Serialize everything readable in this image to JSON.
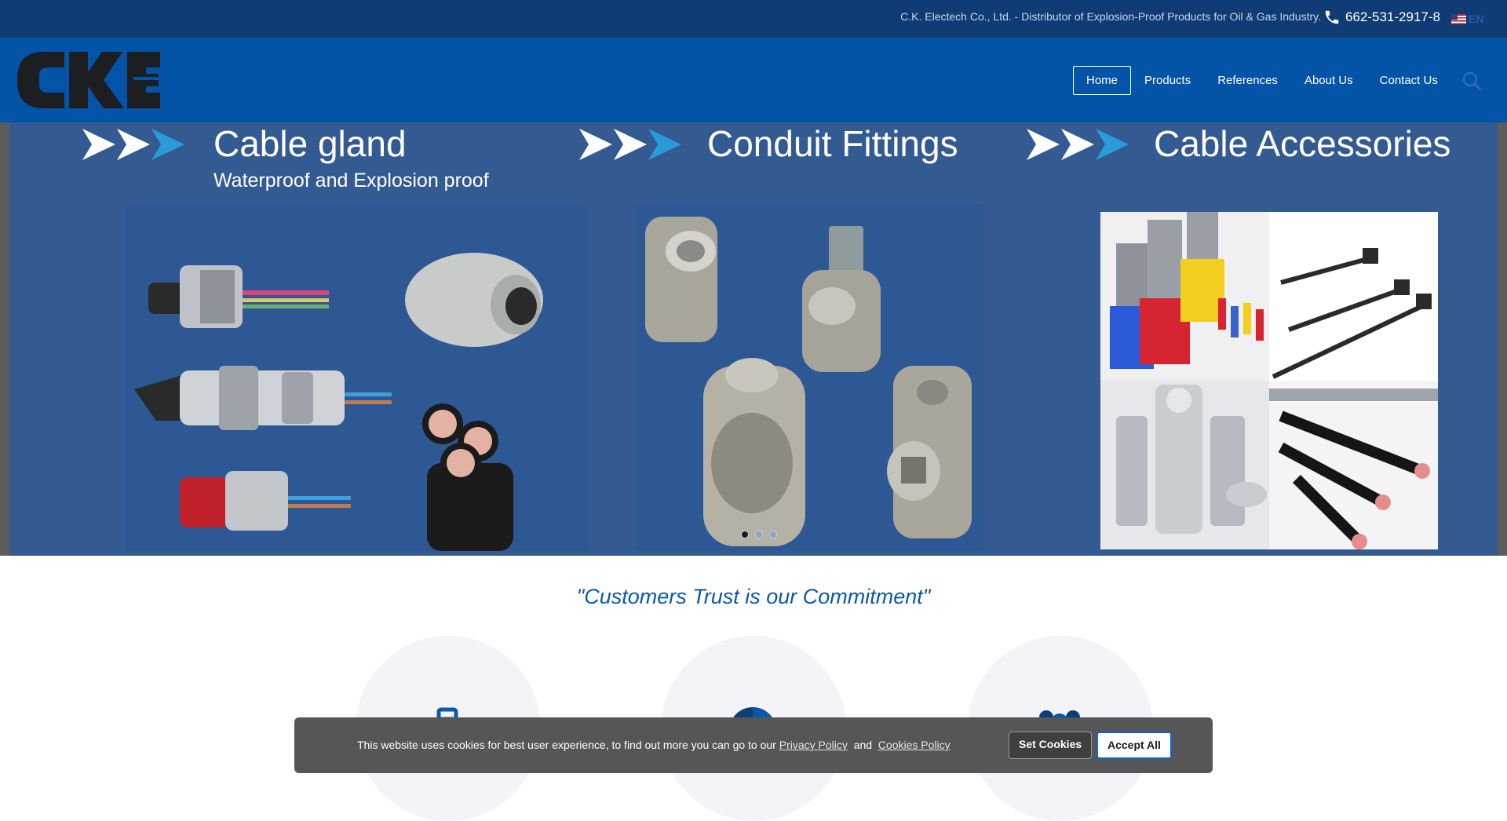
{
  "topbar": {
    "tagline": "C.K. Electech Co., Ltd. - Distributor of Explosion-Proof Products for Oil & Gas Industry.",
    "phone": "662-531-2917-8",
    "language": "EN"
  },
  "nav": {
    "items": [
      {
        "label": "Home",
        "active": true
      },
      {
        "label": "Products",
        "active": false
      },
      {
        "label": "References",
        "active": false
      },
      {
        "label": "About Us",
        "active": false
      },
      {
        "label": "Contact Us",
        "active": false
      }
    ]
  },
  "hero": {
    "slides": [
      {
        "title": "Cable gland",
        "subtitle": "Waterproof and Explosion proof"
      },
      {
        "title": "Conduit Fittings",
        "subtitle": ""
      },
      {
        "title": "Cable Accessories",
        "subtitle": ""
      }
    ],
    "dots": [
      {
        "active": true
      },
      {
        "active": false
      },
      {
        "active": false
      }
    ]
  },
  "commitment": {
    "text": "\"Customers Trust is our Commitment\""
  },
  "features": [
    {
      "icon": "briefcase-icon"
    },
    {
      "icon": "pie-chart-icon"
    },
    {
      "icon": "users-icon"
    }
  ],
  "cookie": {
    "message": "This website uses cookies for best user experience, to find out more you can go to our",
    "privacy_link": "Privacy Policy",
    "and": "and",
    "cookies_link": "Cookies Policy",
    "set_label": "Set Cookies",
    "accept_label": "Accept All"
  },
  "colors": {
    "topbar": "#0f3c74",
    "header": "#0353a6",
    "hero": "#345a92",
    "accent": "#0a58a8",
    "arrow_accent": "#2b9ad9"
  }
}
